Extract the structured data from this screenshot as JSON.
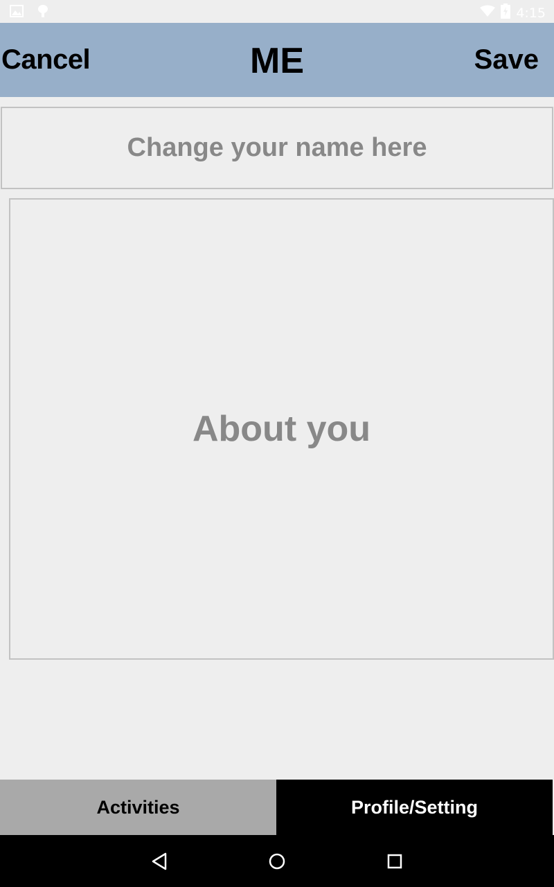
{
  "status_bar": {
    "time": "4:15",
    "icons": [
      "image-icon",
      "android-icon",
      "wifi-icon",
      "battery-icon"
    ]
  },
  "header": {
    "title": "ME",
    "cancel_label": "Cancel",
    "save_label": "Save",
    "background_color": "#97afc9"
  },
  "form": {
    "name_placeholder": "Change your name here",
    "about_placeholder": "About you"
  },
  "tabs": [
    {
      "label": "Activities",
      "selected": false
    },
    {
      "label": "Profile/Setting",
      "selected": true
    }
  ],
  "nav_bar": {
    "icons": [
      "back-icon",
      "home-icon",
      "recent-apps-icon"
    ]
  }
}
